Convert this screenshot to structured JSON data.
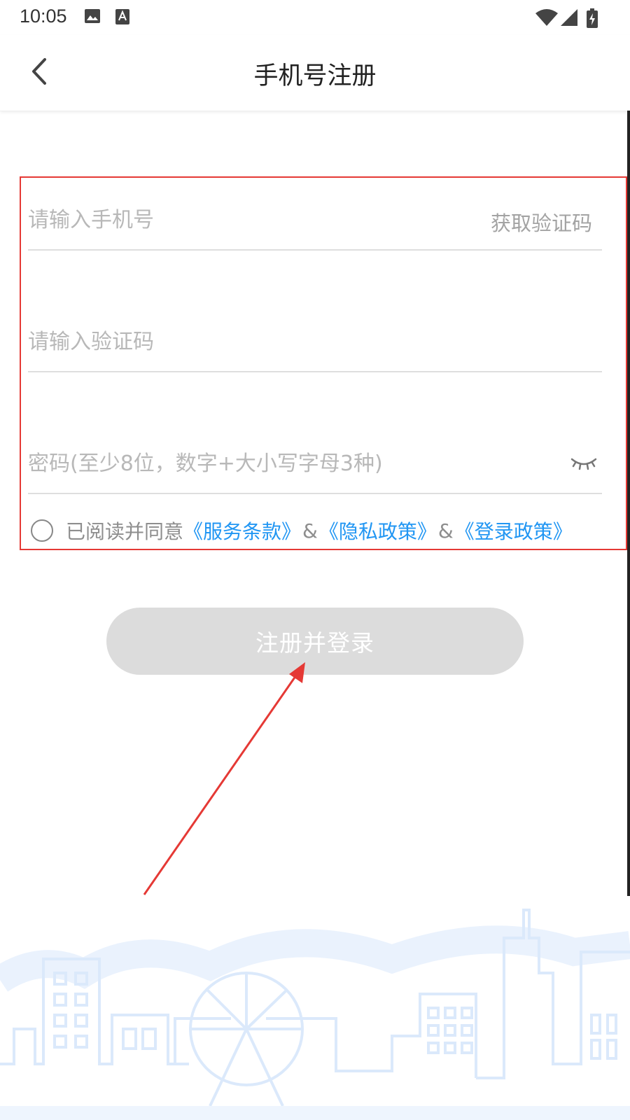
{
  "status_bar": {
    "time": "10:05"
  },
  "header": {
    "title": "手机号注册"
  },
  "form": {
    "phone_placeholder": "请输入手机号",
    "get_code_label": "获取验证码",
    "code_placeholder": "请输入验证码",
    "password_placeholder": "密码(至少8位，数字+大小写字母3种)",
    "agree": {
      "prefix": "已阅读并同意",
      "terms": "《服务条款》",
      "amp1": "&",
      "privacy": "《隐私政策》",
      "amp2": "&",
      "login_policy": "《登录政策》",
      "checked": false
    },
    "submit_label": "注册并登录"
  },
  "colors": {
    "link": "#2196f3",
    "highlight_frame": "#e53935",
    "button_disabled": "#dcdcdc",
    "skyline": "#dbe9fb"
  }
}
